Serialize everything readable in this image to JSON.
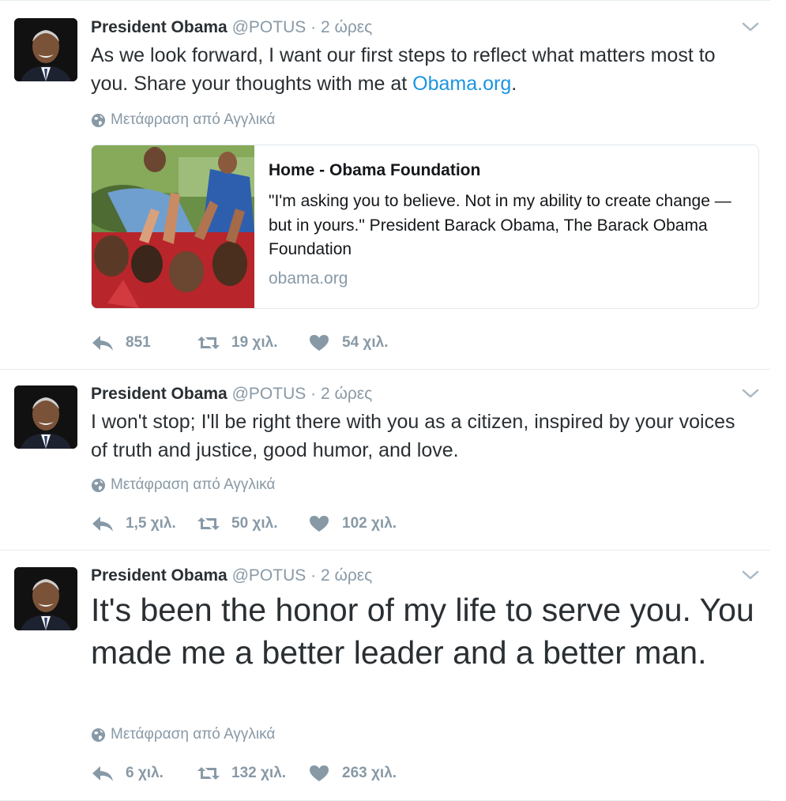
{
  "tweets": [
    {
      "author_name": "President Obama",
      "handle": "@POTUS",
      "separator": "·",
      "time": "2 ώρες",
      "text_before_link": "As we look forward, I want our first steps to reflect what matters most to you. Share your thoughts with me at ",
      "link_text": "Obama.org",
      "text_after_link": ".",
      "translate_label": "Μετάφραση από Αγγλικά",
      "card": {
        "title": "Home - Obama Foundation",
        "description": "\"I'm asking you to believe. Not in my ability to create change — but in yours.\" President Barack Obama, The Barack Obama Foundation",
        "domain": "obama.org"
      },
      "replies": "851",
      "retweets": "19 χιλ.",
      "likes": "54 χιλ."
    },
    {
      "author_name": "President Obama",
      "handle": "@POTUS",
      "separator": "·",
      "time": "2 ώρες",
      "text": "I won't stop; I'll be right there with you as a citizen, inspired by your voices of truth and justice, good humor, and love.",
      "translate_label": "Μετάφραση από Αγγλικά",
      "replies": "1,5 χιλ.",
      "retweets": "50 χιλ.",
      "likes": "102 χιλ."
    },
    {
      "author_name": "President Obama",
      "handle": "@POTUS",
      "separator": "·",
      "time": "2 ώρες",
      "text": "It's been the honor of my life to serve you. You made me a better leader and a better man.",
      "translate_label": "Μετάφραση από Αγγλικά",
      "replies": "6 χιλ.",
      "retweets": "132 χιλ.",
      "likes": "263 χιλ."
    }
  ],
  "icons": {
    "avatar": "profile-photo",
    "chevron": "chevron-down-icon",
    "translate": "globe-icon",
    "reply": "reply-icon",
    "retweet": "retweet-icon",
    "like": "heart-icon"
  },
  "colors": {
    "link": "#1b95e0",
    "muted": "#8899a6",
    "text": "#292f33",
    "divider": "#e6ecf0"
  }
}
